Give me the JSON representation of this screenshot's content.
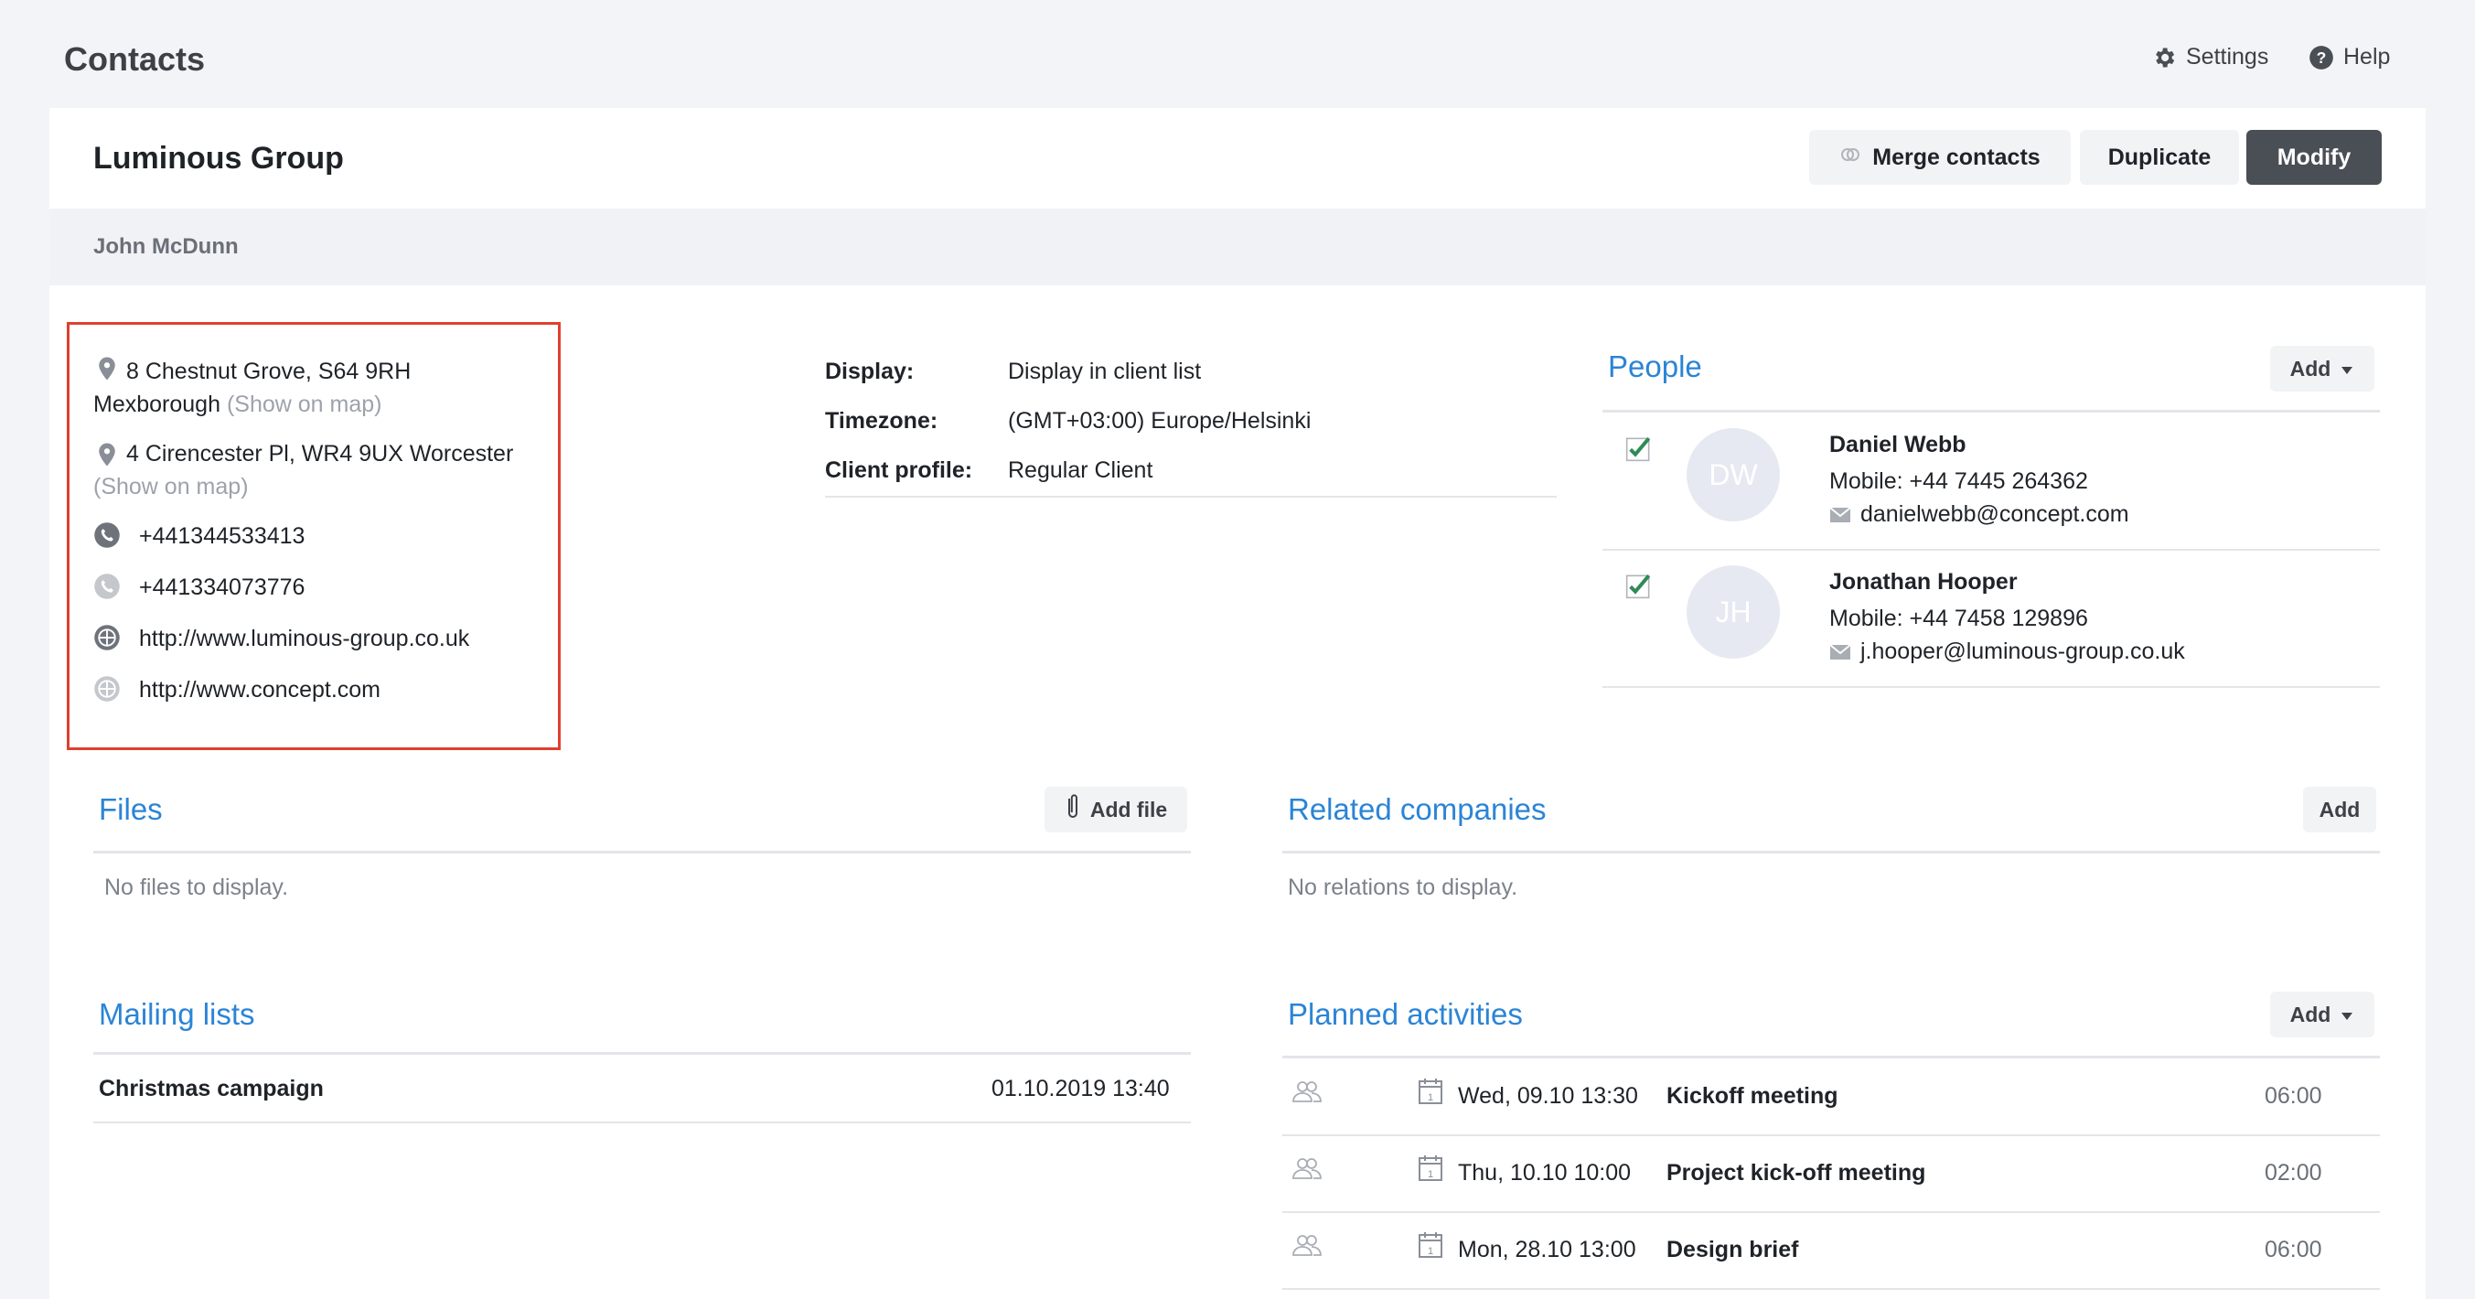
{
  "header": {
    "title": "Contacts",
    "settings_label": "Settings",
    "help_label": "Help"
  },
  "contact": {
    "company_name": "Luminous Group",
    "person_name": "John McDunn",
    "actions": {
      "merge_label": "Merge contacts",
      "duplicate_label": "Duplicate",
      "modify_label": "Modify"
    }
  },
  "addresses": [
    {
      "line1": "8 Chestnut Grove, S64 9RH",
      "line2": "Mexborough",
      "map_link": "(Show on map)"
    },
    {
      "line1": "4 Cirencester Pl, WR4 9UX Worcester",
      "map_link": "(Show on map)"
    }
  ],
  "phones": [
    "+441344533413",
    "+441334073776"
  ],
  "websites": [
    "http://www.luminous-group.co.uk",
    "http://www.concept.com"
  ],
  "details": [
    {
      "label": "Display:",
      "value": "Display in client list"
    },
    {
      "label": "Timezone:",
      "value": "(GMT+03:00) Europe/Helsinki"
    },
    {
      "label": "Client profile:",
      "value": "Regular Client"
    }
  ],
  "people": {
    "title": "People",
    "add_label": "Add",
    "items": [
      {
        "initials": "DW",
        "name": "Daniel Webb",
        "mobile": "Mobile: +44 7445 264362",
        "email": "danielwebb@concept.com"
      },
      {
        "initials": "JH",
        "name": "Jonathan Hooper",
        "mobile": "Mobile: +44 7458 129896",
        "email": "j.hooper@luminous-group.co.uk"
      }
    ]
  },
  "files": {
    "title": "Files",
    "add_label": "Add file",
    "empty_text": "No files to display."
  },
  "related": {
    "title": "Related companies",
    "add_label": "Add",
    "empty_text": "No relations to display."
  },
  "mailing": {
    "title": "Mailing lists",
    "items": [
      {
        "name": "Christmas campaign",
        "date": "01.10.2019 13:40"
      }
    ]
  },
  "activities": {
    "title": "Planned activities",
    "add_label": "Add",
    "items": [
      {
        "date": "Wed, 09.10 13:30",
        "title": "Kickoff meeting",
        "duration": "06:00"
      },
      {
        "date": "Thu, 10.10 10:00",
        "title": "Project kick-off meeting",
        "duration": "02:00"
      },
      {
        "date": "Mon, 28.10 13:00",
        "title": "Design brief",
        "duration": "06:00"
      }
    ]
  },
  "colors": {
    "accent": "#2b84d6",
    "highlight_border": "#e0402f",
    "primary_button": "#4a4e55",
    "check": "#2e8b57"
  },
  "icons": [
    "gear-icon",
    "help-icon",
    "merge-icon",
    "location-pin-icon",
    "phone-icon",
    "globe-icon",
    "caret-down-icon",
    "check-icon",
    "mail-icon",
    "paperclip-icon",
    "people-icon",
    "calendar-icon"
  ]
}
